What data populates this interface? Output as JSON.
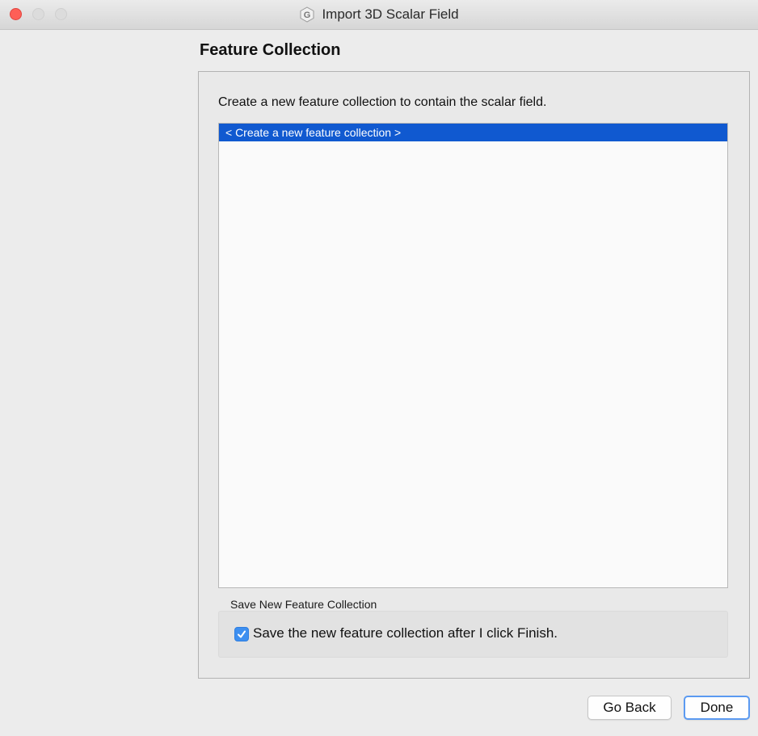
{
  "window": {
    "title": "Import 3D Scalar Field",
    "icon": "app-logo-icon"
  },
  "page": {
    "heading": "Feature Collection",
    "instruction": "Create a new feature collection to contain the scalar field."
  },
  "collection_list": {
    "items": [
      {
        "label": "< Create a new feature collection >",
        "selected": true
      }
    ]
  },
  "save_group": {
    "legend": "Save New Feature Collection",
    "checkbox_label": "Save the new feature collection after I click Finish.",
    "checked": true
  },
  "buttons": {
    "back_label": "Go Back",
    "done_label": "Done"
  },
  "colors": {
    "selection": "#1059d0",
    "checkbox": "#3d8ff0",
    "close": "#fe5f57"
  }
}
